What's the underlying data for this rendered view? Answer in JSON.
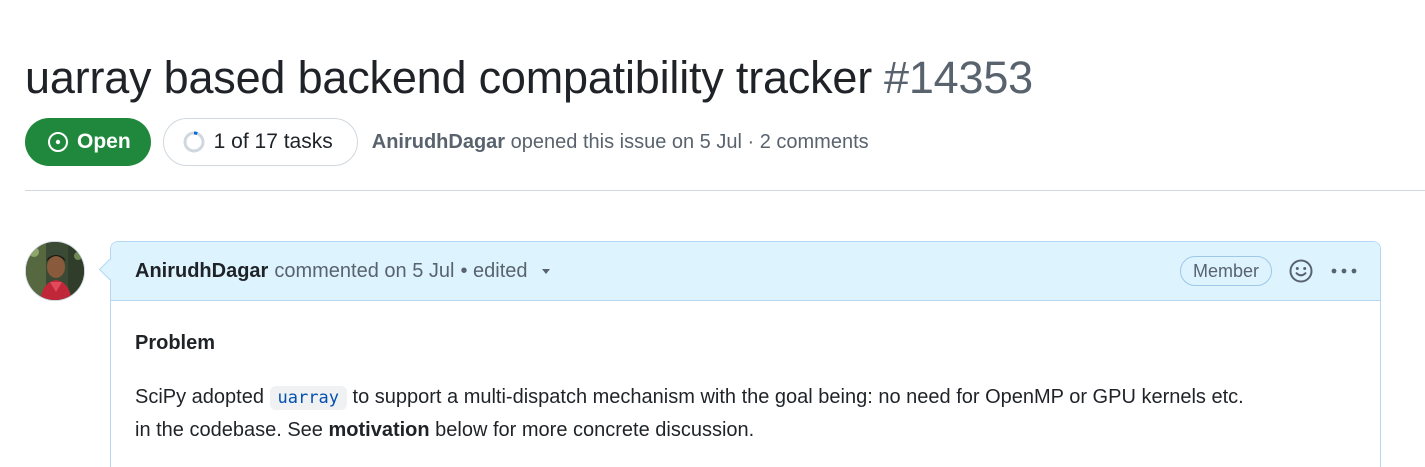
{
  "issue": {
    "title": "uarray based backend compatibility tracker",
    "number": "#14353",
    "state_label": "Open",
    "tasks_label": "1 of 17 tasks",
    "tasks_progress": 0.0588,
    "author": "AnirudhDagar",
    "opened_text": "opened this issue on 5 Jul · 2 comments"
  },
  "comment": {
    "author": "AnirudhDagar",
    "meta": "commented on 5 Jul",
    "edited": "• edited",
    "role_badge": "Member",
    "body": {
      "heading": "Problem",
      "para1_pre": "SciPy adopted ",
      "para1_code": "uarray",
      "para1_post": " to support a multi-dispatch mechanism with the goal being: no need for OpenMP or GPU kernels etc.",
      "para2_pre": "in the codebase. See ",
      "para2_bold": "motivation",
      "para2_post": " below for more concrete discussion."
    }
  },
  "icons": {
    "state": "issue-opened-icon",
    "tasks": "progress-circle-icon",
    "caret": "triangle-down-icon",
    "reaction": "smiley-icon",
    "menu": "kebab-horizontal-icon"
  },
  "colors": {
    "open_green": "#1f883d",
    "header_blue": "#ddf4ff",
    "border_blue": "#b6d7f2",
    "progress_blue": "#0969da"
  }
}
